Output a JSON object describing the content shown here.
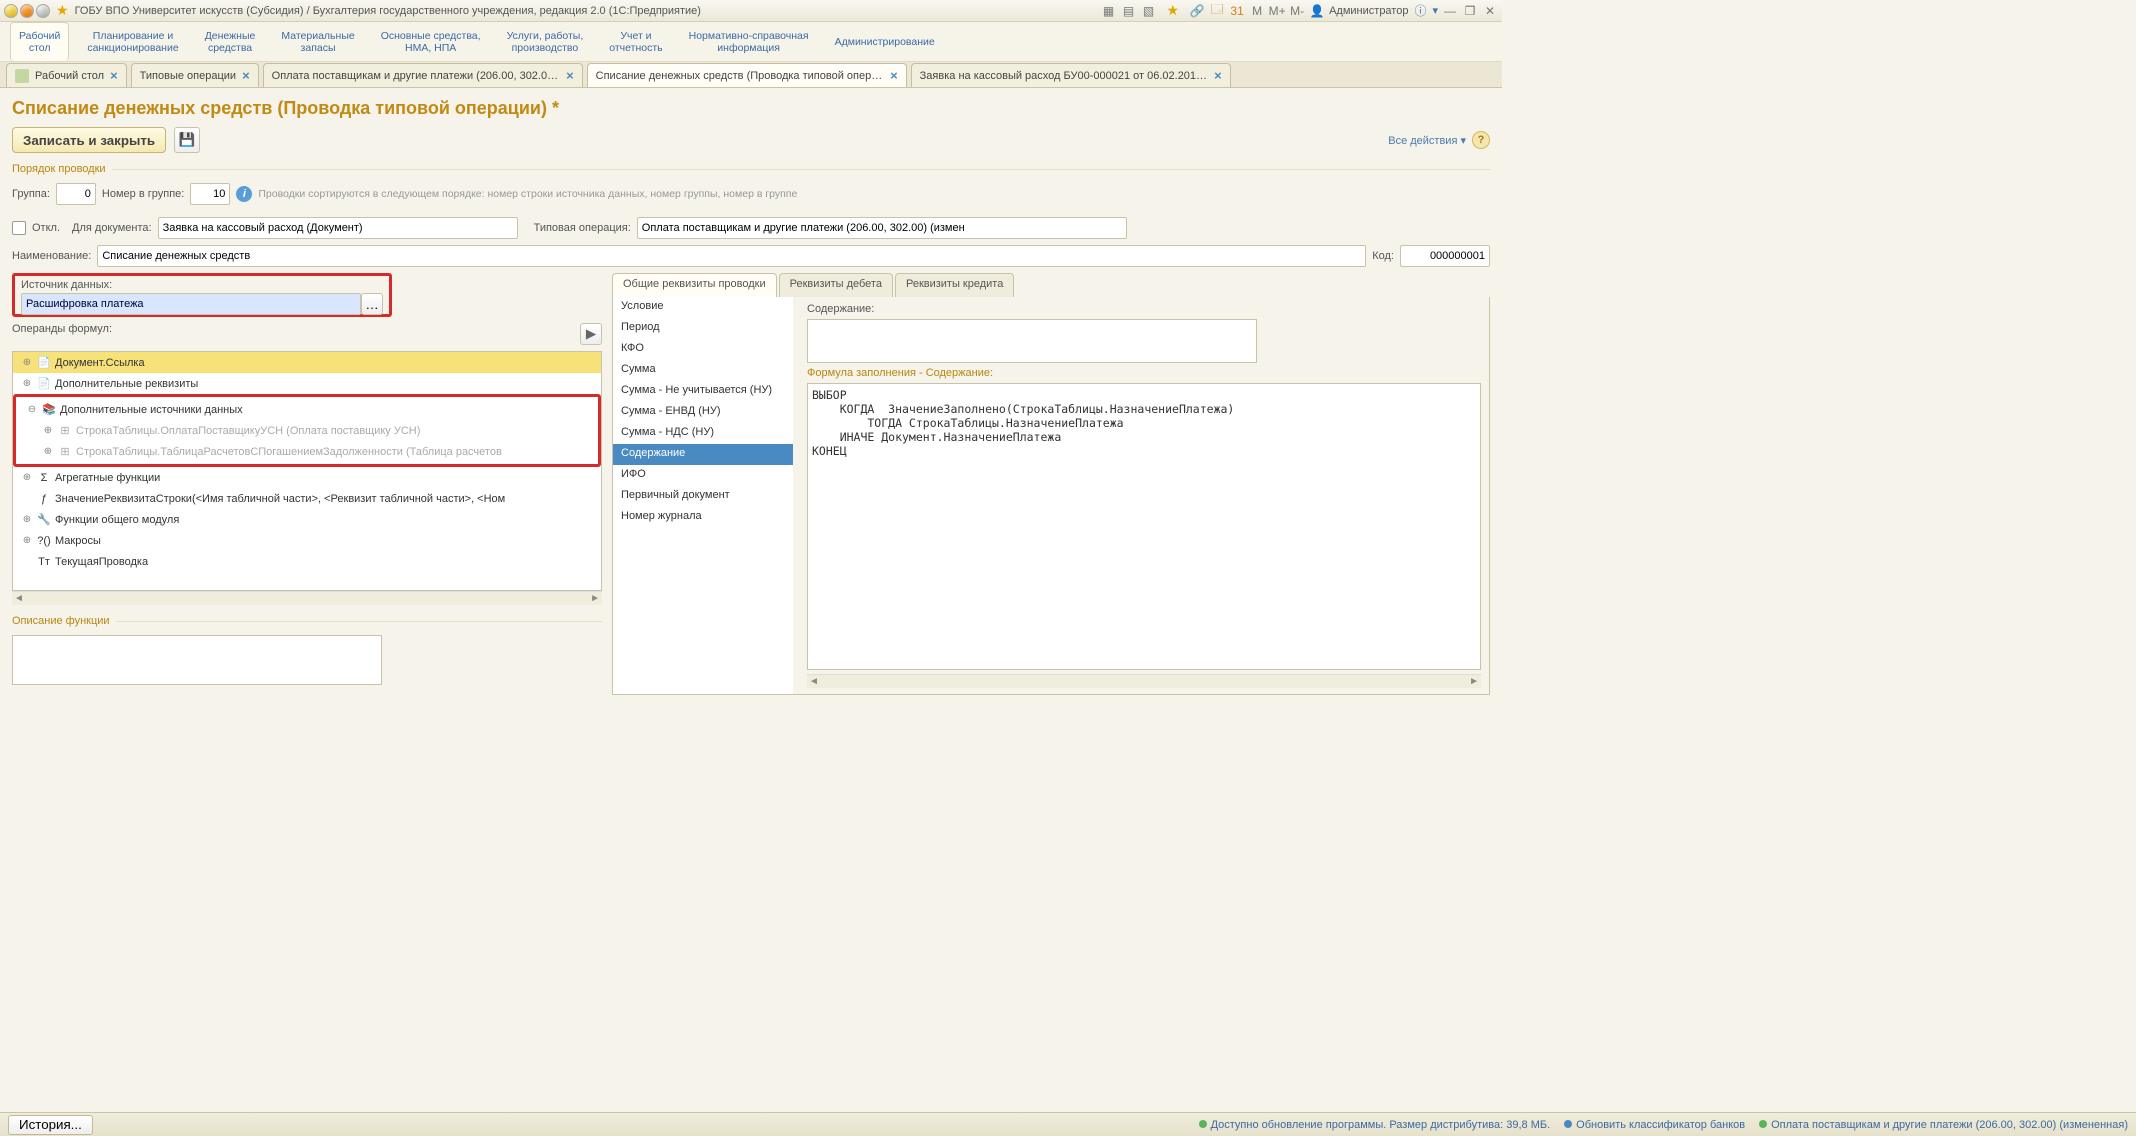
{
  "titlebar": {
    "text": "ГОБУ ВПО Университет искусств (Субсидия) / Бухгалтерия государственного учреждения, редакция 2.0  (1С:Предприятие)",
    "user": "Администратор",
    "m": "M",
    "mp": "M+",
    "mm": "M-"
  },
  "mainmenu": [
    {
      "l1": "Рабочий",
      "l2": "стол"
    },
    {
      "l1": "Планирование и",
      "l2": "санкционирование"
    },
    {
      "l1": "Денежные",
      "l2": "средства"
    },
    {
      "l1": "Материальные",
      "l2": "запасы"
    },
    {
      "l1": "Основные средства,",
      "l2": "НМА, НПА"
    },
    {
      "l1": "Услуги, работы,",
      "l2": "производство"
    },
    {
      "l1": "Учет и",
      "l2": "отчетность"
    },
    {
      "l1": "Нормативно-справочная",
      "l2": "информация"
    },
    {
      "l1": "Администрирование",
      "l2": ""
    }
  ],
  "tabs": [
    {
      "label": "Рабочий стол"
    },
    {
      "label": "Типовые операции"
    },
    {
      "label": "Оплата поставщикам и другие платежи (206.00, 302.00)..."
    },
    {
      "label": "Списание денежных средств (Проводка типовой опера..."
    },
    {
      "label": "Заявка на кассовый расход БУ00-000021 от 06.02.2016..."
    }
  ],
  "activeTabIndex": 3,
  "page": {
    "title": "Списание денежных средств (Проводка типовой операции) *",
    "save": "Записать и закрыть",
    "allacts": "Все действия"
  },
  "order": {
    "legend": "Порядок проводки",
    "group_lbl": "Группа:",
    "group_val": "0",
    "num_lbl": "Номер в группе:",
    "num_val": "10",
    "hint": "Проводки сортируются в следующем порядке: номер строки источника данных, номер группы,  номер в группе"
  },
  "docline": {
    "off": "Откл.",
    "for_doc": "Для документа:",
    "for_doc_val": "Заявка на кассовый расход (Документ)",
    "typ_op": "Типовая операция:",
    "typ_op_val": "Оплата поставщикам и другие платежи (206.00, 302.00) (измен"
  },
  "name": {
    "lbl": "Наименование:",
    "val": "Списание денежных средств",
    "code_lbl": "Код:",
    "code_val": "000000001"
  },
  "src": {
    "lbl": "Источник данных:",
    "val": "Расшифровка платежа"
  },
  "operands": {
    "lbl": "Операнды формул:"
  },
  "tree": [
    {
      "depth": 0,
      "exp": "⊕",
      "icon": "📄",
      "txt": "Документ.Ссылка",
      "sel": true
    },
    {
      "depth": 0,
      "exp": "⊕",
      "icon": "📄",
      "txt": "Дополнительные реквизиты"
    },
    {
      "depth": 0,
      "exp": "⊖",
      "icon": "📚",
      "txt": "Дополнительные источники данных",
      "red": true
    },
    {
      "depth": 1,
      "exp": "⊕",
      "icon": "⊞",
      "txt": "СтрокаТаблицы.ОплатаПоставщикуУСН (Оплата поставщику УСН)",
      "dim": true,
      "red": true
    },
    {
      "depth": 1,
      "exp": "⊕",
      "icon": "⊞",
      "txt": "СтрокаТаблицы.ТаблицаРасчетовСПогашениемЗадолженности (Таблица расчетов",
      "dim": true,
      "red": true
    },
    {
      "depth": 0,
      "exp": "⊕",
      "icon": "Σ",
      "txt": "Агрегатные функции"
    },
    {
      "depth": 0,
      "exp": "",
      "icon": "ƒ",
      "txt": "ЗначениеРеквизитаСтроки(<Имя табличной части>, <Реквизит табличной части>, <Ном"
    },
    {
      "depth": 0,
      "exp": "⊕",
      "icon": "🔧",
      "txt": "Функции общего модуля"
    },
    {
      "depth": 0,
      "exp": "⊕",
      "icon": "?()",
      "txt": "Макросы"
    },
    {
      "depth": 0,
      "exp": "",
      "icon": "Тт",
      "txt": "ТекущаяПроводка"
    }
  ],
  "func_desc": "Описание функции",
  "subtabs": [
    "Общие реквизиты проводки",
    "Реквизиты дебета",
    "Реквизиты кредита"
  ],
  "proplist": [
    "Условие",
    "Период",
    "КФО",
    "Сумма",
    "Сумма - Не учитывается (НУ)",
    "Сумма - ЕНВД (НУ)",
    "Сумма - НДС (НУ)",
    "Содержание",
    "ИФО",
    "Первичный документ",
    "Номер журнала"
  ],
  "propsel": 7,
  "rightpane": {
    "content_lbl": "Содержание:",
    "formula_lbl": "Формула заполнения - Содержание:",
    "formula": "ВЫБОР\n    КОГДА  ЗначениеЗаполнено(СтрокаТаблицы.НазначениеПлатежа)\n        ТОГДА СтрокаТаблицы.НазначениеПлатежа\n    ИНАЧЕ Документ.НазначениеПлатежа\nКОНЕЦ"
  },
  "status": {
    "history": "История...",
    "upd": "Доступно обновление программы. Размер дистрибутива: 39,8 МБ.",
    "upd2": "Обновить классификатор банков",
    "upd3": "Оплата поставщикам и другие платежи (206.00, 302.00) (измененная)"
  }
}
